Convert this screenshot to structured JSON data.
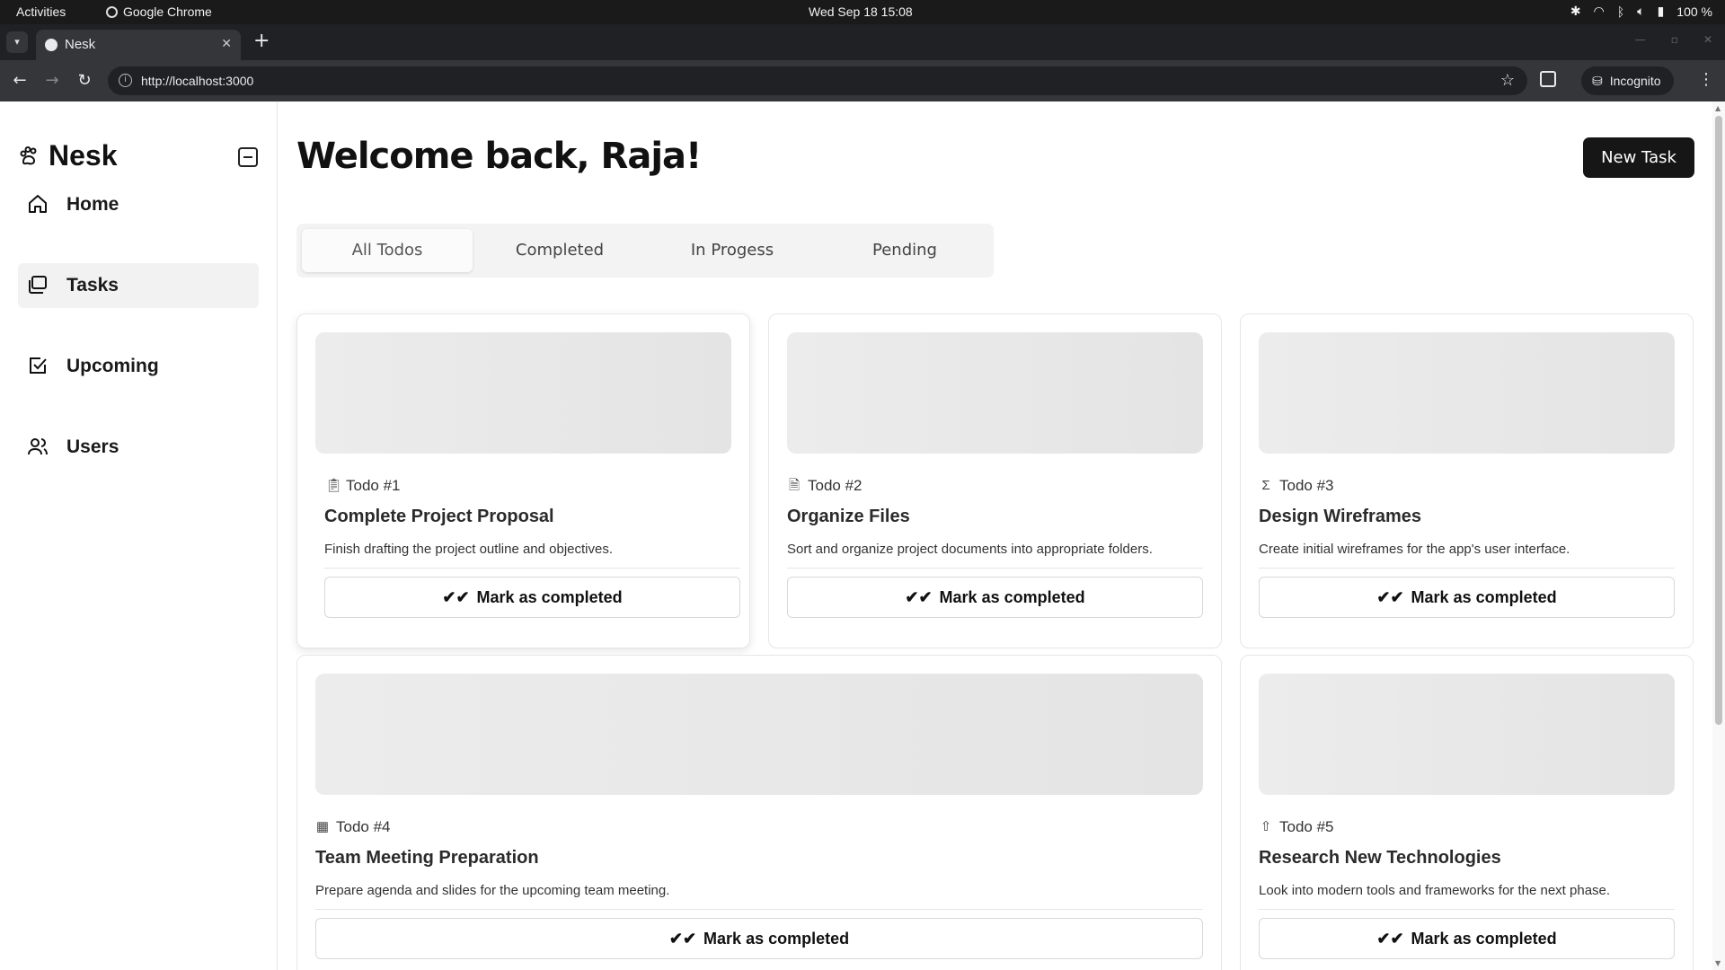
{
  "os": {
    "activities": "Activities",
    "app_name": "Google Chrome",
    "clock": "Wed Sep 18  15:08",
    "battery": "100 %"
  },
  "browser": {
    "tab_title": "Nesk",
    "url": "http://localhost:3000",
    "incognito_label": "Incognito"
  },
  "sidebar": {
    "brand": "Nesk",
    "items": [
      {
        "label": "Home",
        "icon": "home-icon"
      },
      {
        "label": "Tasks",
        "icon": "folders-icon",
        "active": true
      },
      {
        "label": "Upcoming",
        "icon": "checkbox-icon"
      },
      {
        "label": "Users",
        "icon": "users-icon"
      }
    ]
  },
  "main": {
    "welcome": "Welcome back, Raja!",
    "new_task_label": "New Task",
    "tabs": [
      {
        "label": "All Todos",
        "active": true
      },
      {
        "label": "Completed"
      },
      {
        "label": "In Progess"
      },
      {
        "label": "Pending"
      }
    ],
    "mark_label": "Mark as completed",
    "todos": [
      {
        "tag": "Todo #1",
        "icon": "clipboard-icon",
        "title": "Complete Project Proposal",
        "description": "Finish drafting the project outline and objectives."
      },
      {
        "tag": "Todo #2",
        "icon": "file-icon",
        "title": "Organize Files",
        "description": "Sort and organize project documents into appropriate folders."
      },
      {
        "tag": "Todo #3",
        "icon": "sigma-icon",
        "title": "Design Wireframes",
        "description": "Create initial wireframes for the app's user interface."
      },
      {
        "tag": "Todo #4",
        "icon": "table-icon",
        "title": "Team Meeting Preparation",
        "description": "Prepare agenda and slides for the upcoming team meeting."
      },
      {
        "tag": "Todo #5",
        "icon": "arrow-up-icon",
        "title": "Research New Technologies",
        "description": "Look into modern tools and frameworks for the next phase."
      }
    ]
  }
}
